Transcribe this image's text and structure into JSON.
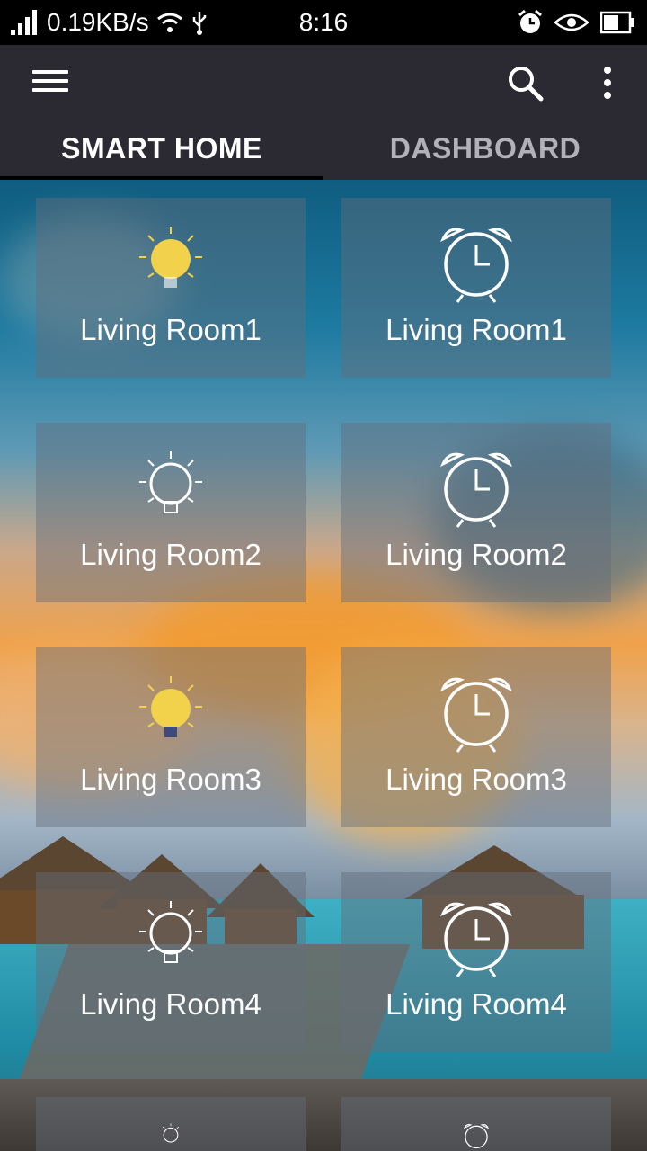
{
  "status_bar": {
    "speed": "0.19KB/s",
    "time": "8:16"
  },
  "app_bar": {
    "menu_icon": "hamburger-menu-icon",
    "search_icon": "search-icon",
    "more_icon": "more-vertical-icon"
  },
  "tabs": [
    {
      "label": "SMART HOME",
      "active": true
    },
    {
      "label": "DASHBOARD",
      "active": false
    }
  ],
  "devices": [
    {
      "label": "Living Room1",
      "icon": "lightbulb-icon",
      "state": "on"
    },
    {
      "label": "Living Room1",
      "icon": "alarm-clock-icon"
    },
    {
      "label": "Living Room2",
      "icon": "lightbulb-icon",
      "state": "off"
    },
    {
      "label": "Living Room2",
      "icon": "alarm-clock-icon"
    },
    {
      "label": "Living Room3",
      "icon": "lightbulb-icon",
      "state": "on"
    },
    {
      "label": "Living Room3",
      "icon": "alarm-clock-icon"
    },
    {
      "label": "Living Room4",
      "icon": "lightbulb-icon",
      "state": "off"
    },
    {
      "label": "Living Room4",
      "icon": "alarm-clock-icon"
    }
  ],
  "colors": {
    "app_bar": "#2b2932",
    "bulb_on": "#f2d24b",
    "tile_overlay": "#646c7a"
  }
}
